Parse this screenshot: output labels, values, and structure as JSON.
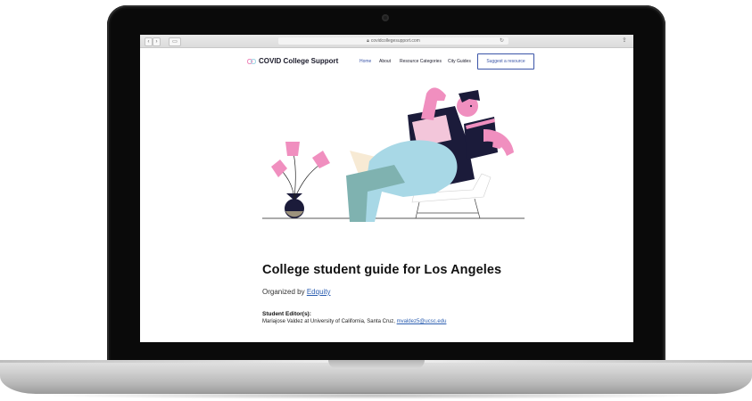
{
  "browser": {
    "url": "covidcollegesupport.com",
    "back_glyph": "‹",
    "forward_glyph": "›",
    "sidebar_glyph": "▭",
    "reload_glyph": "↻",
    "share_glyph": "⇪"
  },
  "site": {
    "logo_text": "COVID College Support",
    "nav": [
      {
        "label": "Home"
      },
      {
        "label": "About"
      },
      {
        "label": "Resource Categories"
      },
      {
        "label": "City Guides"
      }
    ],
    "suggest_label": "Suggest a resource"
  },
  "content": {
    "title": "College student guide for Los Angeles",
    "organized_prefix": "Organized by",
    "organizer_link": "Edquity",
    "editors_label": "Student Editor(s):",
    "editor_text": "Mariajose Valdez at University of California, Santa Cruz,",
    "editor_email": "mvaldez5@ucsc.edu"
  },
  "colors": {
    "accent": "#3b55a8",
    "link": "#2a5db0",
    "illustration_pink": "#f08fbf",
    "illustration_blue": "#a8d8e6",
    "illustration_navy": "#1b1b3a"
  },
  "icons": {
    "lock": "lock-icon",
    "reload": "reload-icon",
    "share": "share-icon"
  }
}
